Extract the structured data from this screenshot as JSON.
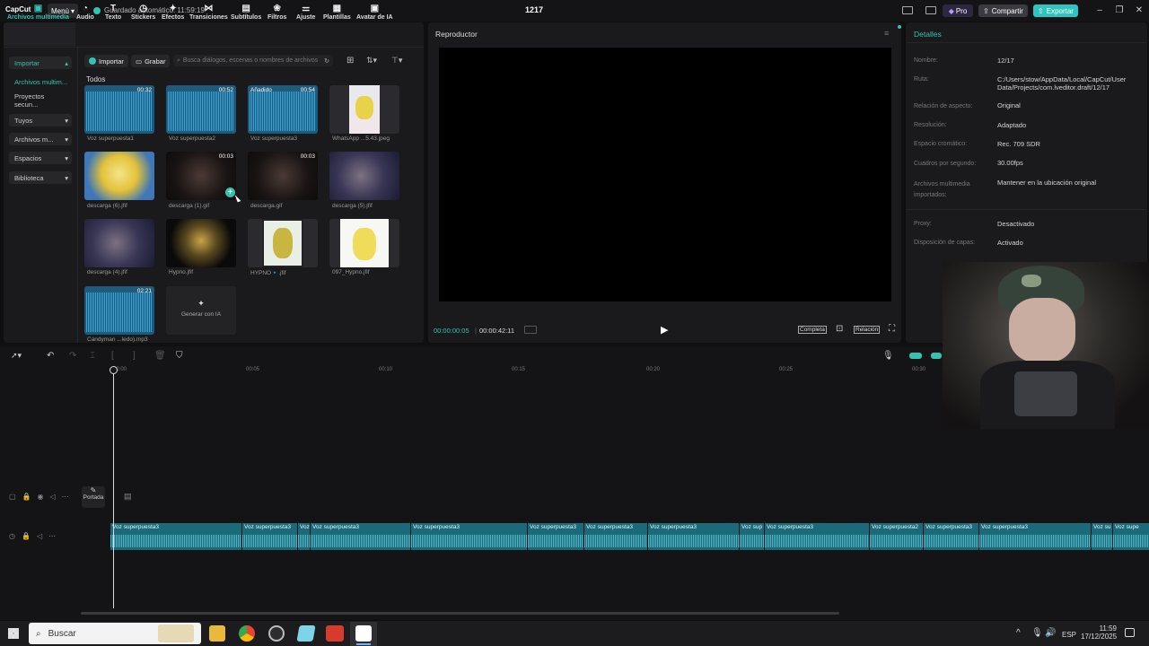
{
  "titlebar": {
    "logo": "CapCut",
    "menu": "Menú",
    "autosave": "Guardado automático: 11:59:19",
    "project_title": "1217",
    "pro": "Pro",
    "share": "Compartir",
    "export": "Exportar"
  },
  "tools": [
    {
      "label": "Archivos multimedia",
      "icon": "media-icon"
    },
    {
      "label": "Audio",
      "icon": "audio-icon"
    },
    {
      "label": "Texto",
      "icon": "text-icon"
    },
    {
      "label": "Stickers",
      "icon": "sticker-icon"
    },
    {
      "label": "Efectos",
      "icon": "effects-icon"
    },
    {
      "label": "Transiciones",
      "icon": "transitions-icon"
    },
    {
      "label": "Subtítulos",
      "icon": "subtitles-icon"
    },
    {
      "label": "Filtros",
      "icon": "filters-icon"
    },
    {
      "label": "Ajuste",
      "icon": "adjust-icon"
    },
    {
      "label": "Plantillas",
      "icon": "templates-icon"
    },
    {
      "label": "Avatar de IA",
      "icon": "avatar-icon"
    }
  ],
  "sidebar": {
    "items": [
      {
        "label": "Importar"
      },
      {
        "label": "Archivos multim..."
      },
      {
        "label": "Proyectos secun..."
      },
      {
        "label": "Tuyos"
      },
      {
        "label": "Archivos m..."
      },
      {
        "label": "Espacios"
      },
      {
        "label": "Biblioteca"
      }
    ]
  },
  "media_toolbar": {
    "import": "Importar",
    "record": "Grabar",
    "search_placeholder": "Busca diálogos, escenas o nombres de archivos"
  },
  "media": {
    "section": "Todos",
    "items": [
      {
        "name": "Voz superpuesta1",
        "duration": "00:32",
        "type": "audio"
      },
      {
        "name": "Voz superpuesta2",
        "duration": "00:52",
        "type": "audio"
      },
      {
        "name": "Voz superpuesta3",
        "duration": "00:54",
        "badge": "Añadido",
        "type": "audio"
      },
      {
        "name": "WhatsApp ...5.43.jpeg",
        "type": "image"
      },
      {
        "name": "descarga (6).jfif",
        "type": "image"
      },
      {
        "name": "descarga (1).gif",
        "duration": "00:03",
        "type": "gif"
      },
      {
        "name": "descarga.gif",
        "duration": "00:03",
        "type": "gif"
      },
      {
        "name": "descarga (5).jfif",
        "type": "image"
      },
      {
        "name": "descarga (4).jfif",
        "type": "image"
      },
      {
        "name": "Hypno.jfif",
        "type": "image"
      },
      {
        "name": "HYPNO🔹.jfif",
        "type": "image"
      },
      {
        "name": "097_Hypno.jfif",
        "type": "image"
      },
      {
        "name": "Candyman ...ledo).mp3",
        "duration": "02:21",
        "type": "audio"
      }
    ],
    "generate": "Generar con IA"
  },
  "player": {
    "title": "Reproductor",
    "current_time": "00:00:00:05",
    "total_time": "00:00:42:11",
    "full": "Completa",
    "ratio": "Relación"
  },
  "details": {
    "title": "Detalles",
    "rows": [
      {
        "label": "Nombre:",
        "value": "12/17"
      },
      {
        "label": "Ruta:",
        "value": "C:/Users/stow/AppData/Local/CapCut/User Data/Projects/com.lveditor.draft/12/17"
      },
      {
        "label": "Relación de aspecto:",
        "value": "Original"
      },
      {
        "label": "Resolución:",
        "value": "Adaptado"
      },
      {
        "label": "Espacio cromático:",
        "value": "Rec. 709 SDR"
      },
      {
        "label": "Cuadros por segundo:",
        "value": "30.00fps"
      },
      {
        "label": "Archivos multimedia importados:",
        "value": "Mantener en la ubicación original"
      },
      {
        "label": "Proxy:",
        "value": "Desactivado"
      },
      {
        "label": "Disposición de capas:",
        "value": "Activado"
      }
    ]
  },
  "timeline": {
    "ruler": [
      "00:00",
      "00:05",
      "00:10",
      "00:15",
      "00:20",
      "00:25",
      "00:30"
    ],
    "cover": "Portada",
    "clips": [
      "Voz superpuesta3",
      "Voz superpuesta3",
      "Voz",
      "Voz superpuesta3",
      "Voz superpuesta3",
      "Voz superpuesta3",
      "Voz superpuesta3",
      "Voz superpuesta3",
      "Voz sup",
      "Voz superpuesta3",
      "Voz superpuesta2",
      "Voz superpuesta3",
      "Voz superpuesta3",
      "Voz su",
      "Voz supe"
    ]
  },
  "taskbar": {
    "search": "Buscar",
    "lang": "ESP",
    "time": "11:59",
    "date": "17/12/2025"
  }
}
